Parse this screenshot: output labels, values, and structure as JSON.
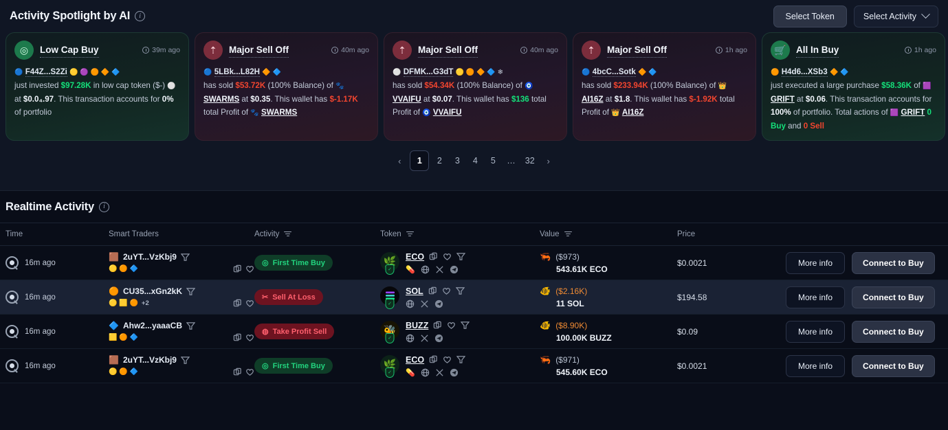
{
  "spotlight": {
    "title": "Activity Spotlight by AI",
    "info_icon": "info-icon",
    "select_token_label": "Select Token",
    "select_activity_label": "Select Activity",
    "cards": [
      {
        "type": "green",
        "icon": "target-icon",
        "title": "Low Cap Buy",
        "time": "39m ago",
        "wallet": "F44Z...S2Zi",
        "wallet_badges": "◆◆◆◆◆",
        "text_1": "just invested ",
        "amount": "$97.28K",
        "amount_dir": "up",
        "text_2": " in low cap token ($-)",
        "text_3": " at ",
        "price": "$0.0₄.97",
        "text_4": ". This transaction accounts for ",
        "pct": "0%",
        "text_5": " of portfolio",
        "token": "",
        "token_price": ""
      },
      {
        "type": "red",
        "icon": "sell-off-icon",
        "title": "Major Sell Off",
        "time": "40m ago",
        "wallet": "5LBk...L82H",
        "text_1": "has sold ",
        "amount": "$53.72K",
        "amount_dir": "down",
        "text_2": " (100% Balance) of ",
        "token": "SWARMS",
        "text_3": " at ",
        "price": "$0.35",
        "text_4": ". This wallet has ",
        "profit": "$-1.17K",
        "profit_dir": "down",
        "text_5": " total Profit of ",
        "token2": "SWARMS"
      },
      {
        "type": "red",
        "icon": "sell-off-icon",
        "title": "Major Sell Off",
        "time": "40m ago",
        "wallet": "DFMK...G3dT",
        "text_1": "has sold ",
        "amount": "$54.34K",
        "amount_dir": "down",
        "text_2": " (100% Balance) of ",
        "token": "VVAIFU",
        "text_3": " at ",
        "price": "$0.07",
        "text_4": ". This wallet has ",
        "profit": "$136",
        "profit_dir": "up",
        "text_5": " total Profit of ",
        "token2": "VVAIFU"
      },
      {
        "type": "red",
        "icon": "sell-off-icon",
        "title": "Major Sell Off",
        "time": "1h ago",
        "wallet": "4bcC...Sotk",
        "text_1": "has sold ",
        "amount": "$233.94K",
        "amount_dir": "down",
        "text_2": " (100% Balance) of ",
        "token": "AI16Z",
        "text_3": " at ",
        "price": "$1.8",
        "text_4": ". This wallet has ",
        "profit": "$-1.92K",
        "profit_dir": "down",
        "text_5": " total Profit of ",
        "token2": "AI16Z"
      },
      {
        "type": "green",
        "icon": "cart-icon",
        "title": "All In Buy",
        "time": "1h ago",
        "wallet": "H4d6...XSb3",
        "text_1": "just executed a large purchase ",
        "amount": "$58.36K",
        "amount_dir": "up",
        "text_2": " of ",
        "token": "GRIFT",
        "text_3": " at ",
        "price": "$0.06",
        "text_4": ". This transaction accounts for ",
        "pct": "100%",
        "text_5": " of portfolio. Total actions of ",
        "token2": "GRIFT",
        "buy_count": "0 Buy",
        "and_text": " and ",
        "sell_count": "0 Sell"
      }
    ]
  },
  "pagination": {
    "prev": "‹",
    "next": "›",
    "pages": [
      "1",
      "2",
      "3",
      "4",
      "5",
      "…",
      "32"
    ],
    "active": "1"
  },
  "realtime": {
    "title": "Realtime Activity",
    "columns": [
      {
        "label": "Time",
        "filter": false
      },
      {
        "label": "Smart Traders",
        "filter": false
      },
      {
        "label": "Activity",
        "filter": true
      },
      {
        "label": "Token",
        "filter": true
      },
      {
        "label": "Value",
        "filter": true
      },
      {
        "label": "Price",
        "filter": false
      },
      {
        "label": "",
        "filter": false
      }
    ],
    "more_info_label": "More info",
    "connect_label": "Connect to Buy",
    "rows": [
      {
        "time": "16m ago",
        "trader": "2uYT...VzKbj9",
        "trader_extra": "",
        "activity": "First Time Buy",
        "activity_kind": "buy",
        "activity_icon": "target-icon",
        "token": "ECO",
        "token_logo": "🌿",
        "token_logo_bg": "#0c2218",
        "value_amount": "($973)",
        "value_amount_color": "grey",
        "value_qty": "543.61K ECO",
        "value_icon": "shrimp-icon",
        "price": "$0.0021",
        "highlight": false
      },
      {
        "time": "16m ago",
        "trader": "CU35...xGn2kK",
        "trader_extra": "+2",
        "activity": "Sell At Loss",
        "activity_kind": "loss",
        "activity_icon": "scissors-icon",
        "token": "SOL",
        "token_logo": "▤",
        "token_logo_bg": "#0b0b0b",
        "value_amount": "($2.16K)",
        "value_amount_color": "orange",
        "value_qty": "11 SOL",
        "value_icon": "fish-icon",
        "price": "$194.58",
        "highlight": true
      },
      {
        "time": "16m ago",
        "trader": "Ahw2...yaaaCB",
        "trader_extra": "",
        "activity": "Take Profit Sell",
        "activity_kind": "profit",
        "activity_icon": "coin-icon",
        "token": "BUZZ",
        "token_logo": "🐝",
        "token_logo_bg": "#1a1504",
        "value_amount": "($8.90K)",
        "value_amount_color": "orange",
        "value_qty": "100.00K BUZZ",
        "value_icon": "fish-icon",
        "price": "$0.09",
        "highlight": false
      },
      {
        "time": "16m ago",
        "trader": "2uYT...VzKbj9",
        "trader_extra": "",
        "activity": "First Time Buy",
        "activity_kind": "buy",
        "activity_icon": "target-icon",
        "token": "ECO",
        "token_logo": "🌿",
        "token_logo_bg": "#0c2218",
        "value_amount": "($971)",
        "value_amount_color": "grey",
        "value_qty": "545.60K ECO",
        "value_icon": "shrimp-icon",
        "price": "$0.0021",
        "highlight": false
      }
    ]
  }
}
